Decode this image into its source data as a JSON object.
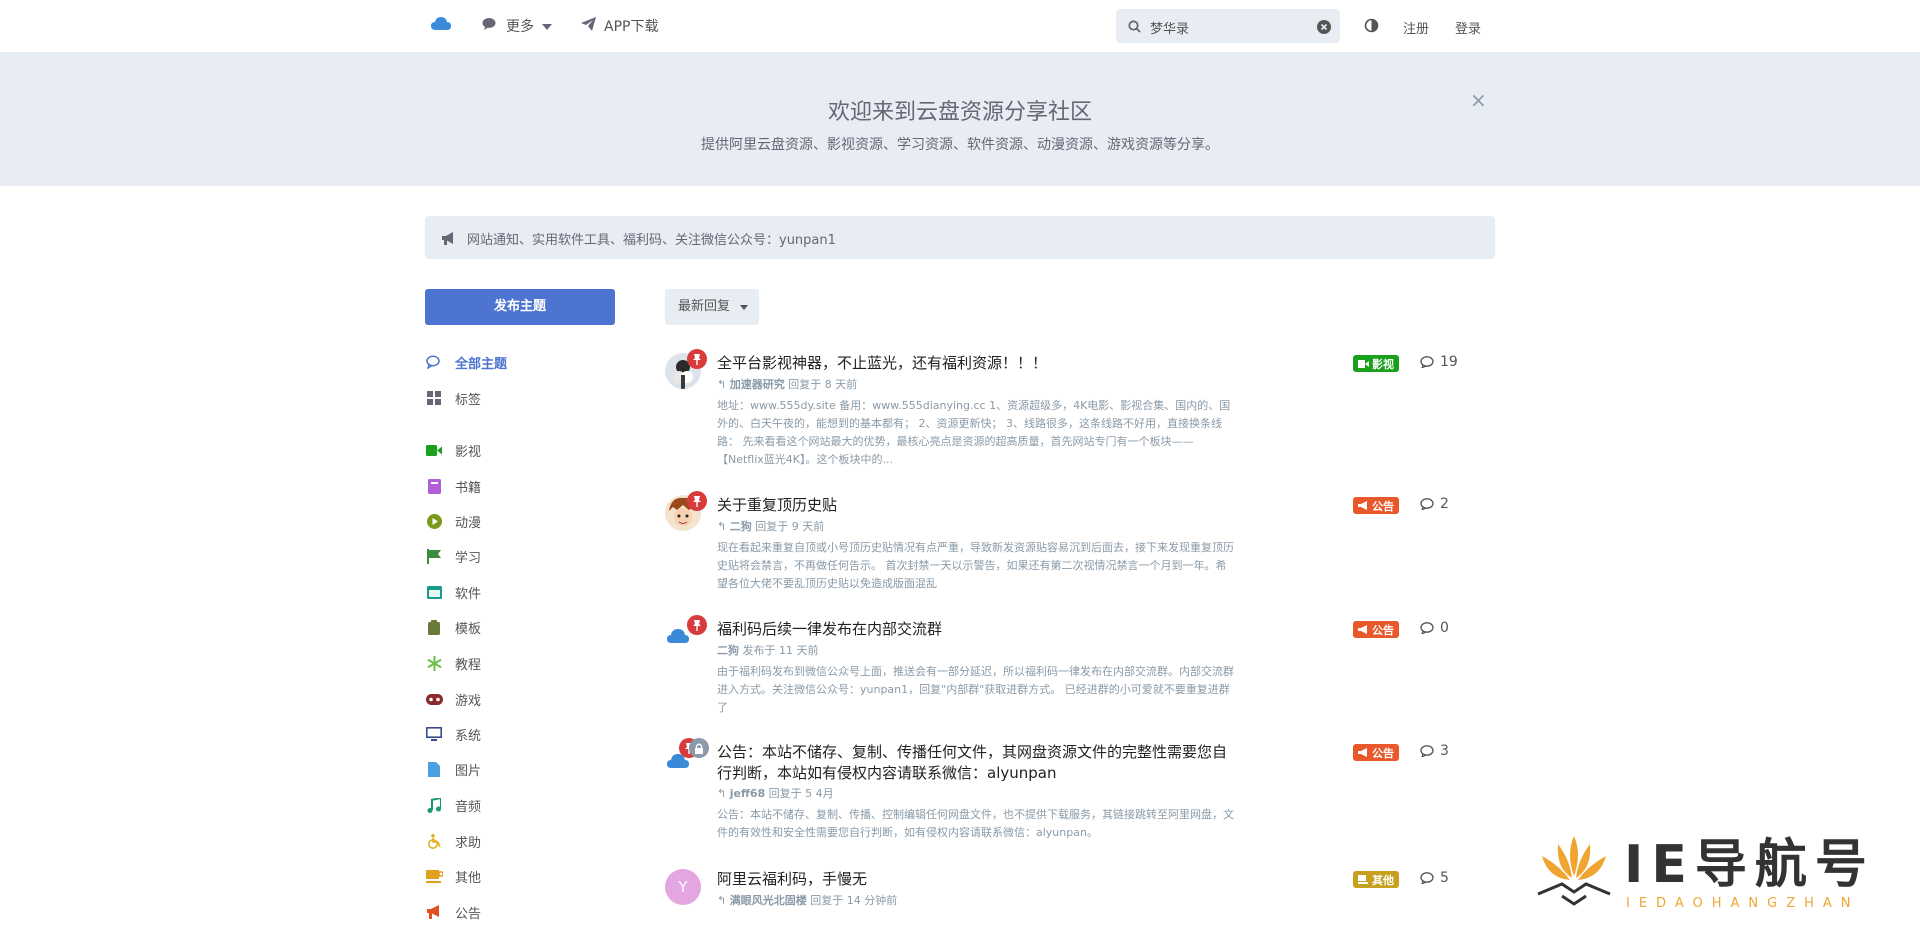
{
  "header": {
    "more_label": "更多",
    "app_label": "APP下载",
    "search_value": "梦华录",
    "signup_label": "注册",
    "login_label": "登录"
  },
  "hero": {
    "title": "欢迎来到云盘资源分享社区",
    "subtitle": "提供阿里云盘资源、影视资源、学习资源、软件资源、动漫资源、游戏资源等分享。",
    "close_label": "×"
  },
  "notice": {
    "text": "网站通知、实用软件工具、福利码、关注微信公众号：yunpan1"
  },
  "sidebar": {
    "start_label": "发布主题",
    "items": [
      {
        "label": "全部主题",
        "icon": "comments-icon",
        "color": "#4d74d0"
      },
      {
        "label": "标签",
        "icon": "grid-icon",
        "color": "#667"
      },
      {
        "label": "影视",
        "icon": "video-icon",
        "color": "#1aa01a"
      },
      {
        "label": "书籍",
        "icon": "book-icon",
        "color": "#b05fd6"
      },
      {
        "label": "动漫",
        "icon": "play-circle-icon",
        "color": "#7a9a1a"
      },
      {
        "label": "学习",
        "icon": "flag-icon",
        "color": "#3c8a3c"
      },
      {
        "label": "软件",
        "icon": "window-icon",
        "color": "#1a9a8a"
      },
      {
        "label": "模板",
        "icon": "clipboard-icon",
        "color": "#6a7a3a"
      },
      {
        "label": "教程",
        "icon": "snowflake-icon",
        "color": "#6ac04a"
      },
      {
        "label": "游戏",
        "icon": "gamepad-icon",
        "color": "#8a2a2a"
      },
      {
        "label": "系统",
        "icon": "monitor-icon",
        "color": "#3a4a8a"
      },
      {
        "label": "图片",
        "icon": "file-icon",
        "color": "#4aa0e0"
      },
      {
        "label": "音频",
        "icon": "music-icon",
        "color": "#1a9a6a"
      },
      {
        "label": "求助",
        "icon": "wheelchair-icon",
        "color": "#e0b020"
      },
      {
        "label": "其他",
        "icon": "coffee-icon",
        "color": "#e0a020"
      },
      {
        "label": "公告",
        "icon": "bullhorn-icon",
        "color": "#e05020"
      }
    ]
  },
  "sort": {
    "label": "最新回复"
  },
  "discussions": [
    {
      "title": "全平台影视神器，不止蓝光，还有福利资源！！！",
      "user": "加速器研究",
      "meta_suffix": "回复于 8 天前",
      "excerpt": "地址：www.555dy.site 备用：www.555dianying.cc 1、资源超级多，4K电影、影视合集、国内的、国外的、白天午夜的，能想到的基本都有； 2、资源更新快； 3、线路很多，这条线路不好用，直接换条线路： 先来看看这个网站最大的优势，最核心亮点是资源的超高质量，首先网站专门有一个板块——【Netflix蓝光4K】。这个板块中的...",
      "tag": "影视",
      "tag_color": "#1aa01a",
      "replies": "19"
    },
    {
      "title": "关于重复顶历史贴",
      "user": "二狗",
      "meta_suffix": "回复于 9 天前",
      "excerpt": "现在看起来重复自顶或小号顶历史贴情况有点严重，导致新发资源贴容易沉到后面去，接下来发现重复顶历史贴将会禁言，不再做任何告示。 首次封禁一天以示警告，如果还有第二次视情况禁言一个月到一年。希望各位大佬不要乱顶历史贴以免造成版面混乱",
      "tag": "公告",
      "tag_color": "#e8582a",
      "replies": "2"
    },
    {
      "title": "福利码后续一律发布在内部交流群",
      "user": "二狗",
      "meta_suffix": "发布于 11 天前",
      "excerpt": "由于福利码发布到微信公众号上面，推送会有一部分延迟，所以福利码一律发布在内部交流群。内部交流群进入方式。关注微信公众号：yunpan1，回复\"内部群\"获取进群方式。 已经进群的小可爱就不要重复进群了",
      "tag": "公告",
      "tag_color": "#e8582a",
      "replies": "0"
    },
    {
      "title": "公告：本站不储存、复制、传播任何文件，其网盘资源文件的完整性需要您自行判断，本站如有侵权内容请联系微信：alyunpan",
      "user": "jeff68",
      "meta_suffix": "回复于 5 4月",
      "excerpt": "公告：本站不储存、复制、传播、控制编辑任何网盘文件，也不提供下载服务，其链接跳转至阿里网盘，文件的有效性和安全性需要您自行判断，如有侵权内容请联系微信：alyunpan。",
      "tag": "公告",
      "tag_color": "#e8582a",
      "replies": "3"
    },
    {
      "title": "阿里云福利码，手慢无",
      "user": "满眼风光北固楼",
      "meta_suffix": "回复于 14 分钟前",
      "excerpt": "",
      "avatar_letter": "Y",
      "tag": "其他",
      "tag_color": "#c8a020",
      "replies": "5"
    }
  ],
  "watermark": {
    "big": "IE导航号",
    "small": "IEDAOHANGZHAN"
  }
}
